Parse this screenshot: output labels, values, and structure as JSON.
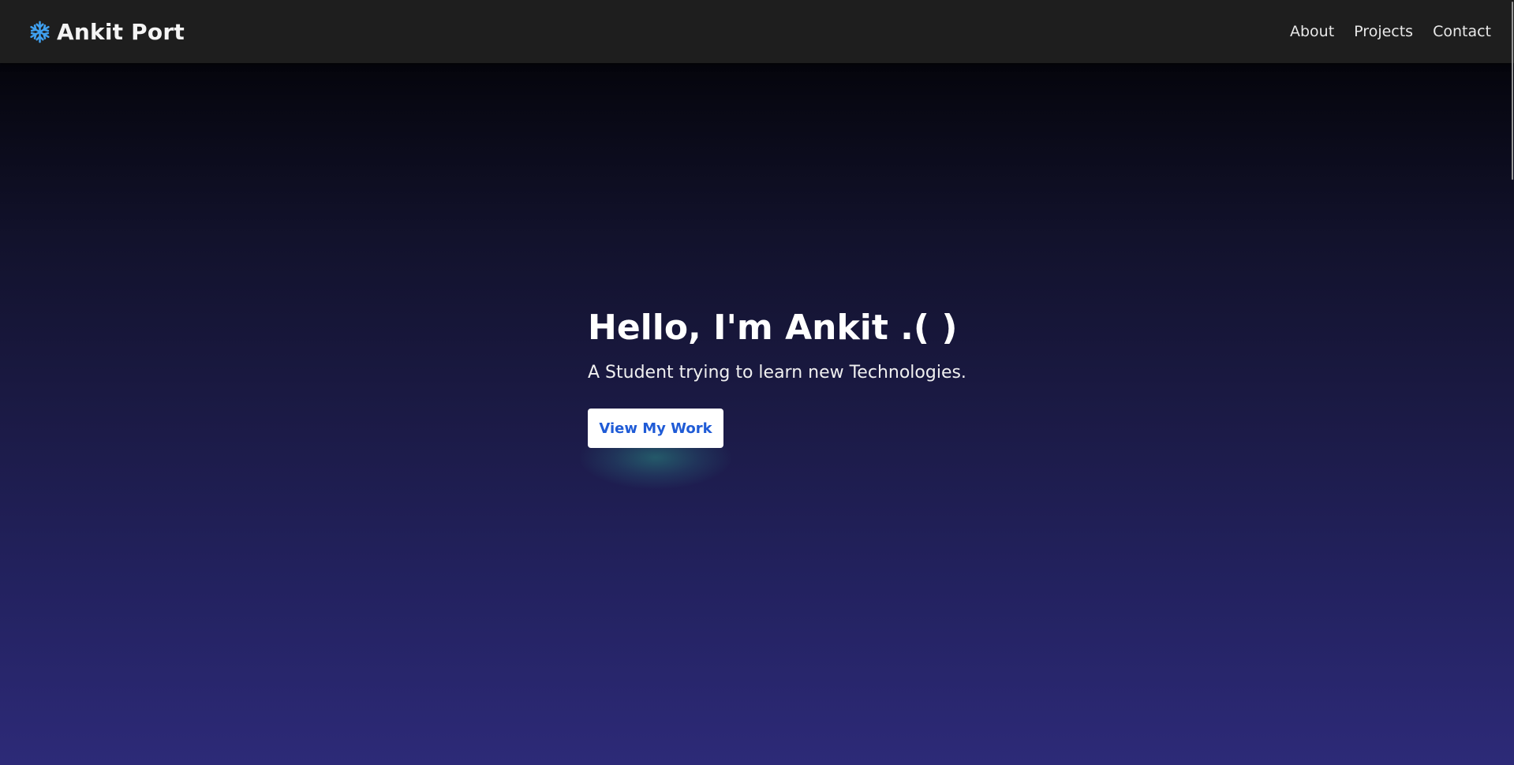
{
  "header": {
    "brand_icon": "snowflake-icon",
    "brand_title": "Ankit Port",
    "nav": [
      {
        "label": "About"
      },
      {
        "label": "Projects"
      },
      {
        "label": "Contact"
      }
    ]
  },
  "hero": {
    "title": "Hello, I'm Ankit .( )",
    "subtitle": "A Student trying to learn new Technologies.",
    "cta_label": "View My Work"
  },
  "colors": {
    "navbar_bg": "#1e1e1e",
    "brand_icon": "#3fa0f0",
    "cta_text": "#1f5bd6",
    "hero_gradient_top": "#05050c",
    "hero_gradient_bottom": "#2d2a78"
  }
}
